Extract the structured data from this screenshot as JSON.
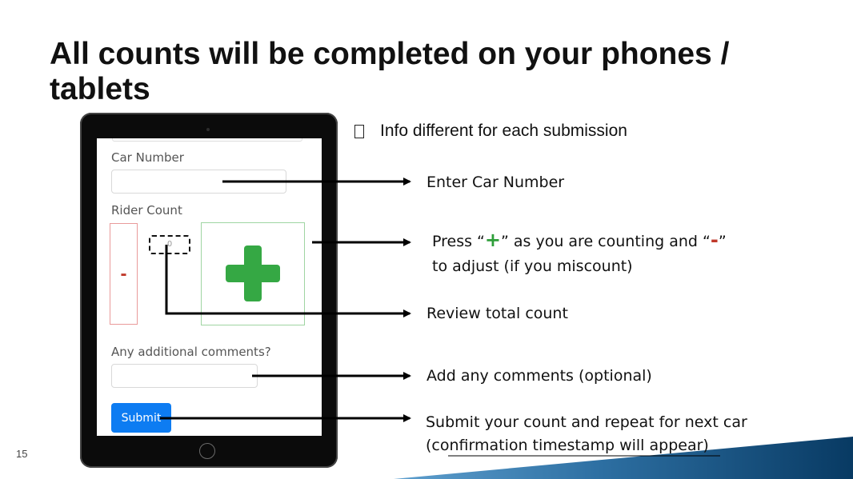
{
  "slide": {
    "title": "All counts will be completed on your phones / tablets",
    "bullet": "Info different for each submission",
    "page_number": "15"
  },
  "form": {
    "car_number_label": "Car Number",
    "car_number_value": "",
    "rider_count_label": "Rider Count",
    "minus_label": "-",
    "count_value": "0",
    "comments_label": "Any additional comments?",
    "comments_value": "",
    "submit_label": "Submit"
  },
  "annotations": {
    "car_number": "Enter Car Number",
    "press_prefix": "Press “",
    "press_plus": "+",
    "press_middle": "” as you are counting and “",
    "press_minus": "-",
    "press_suffix": "”",
    "press_line2": "to adjust (if you miscount)",
    "review": "Review total count",
    "comments": "Add any comments (optional)",
    "submit_line1": "Submit your count and repeat for next car",
    "submit_line2": "(confirmation timestamp will appear)"
  },
  "colors": {
    "plus_green": "#35a844",
    "minus_red": "#c0392b",
    "submit_blue": "#0d7cf2",
    "accent_navy": "#0b3d66"
  }
}
